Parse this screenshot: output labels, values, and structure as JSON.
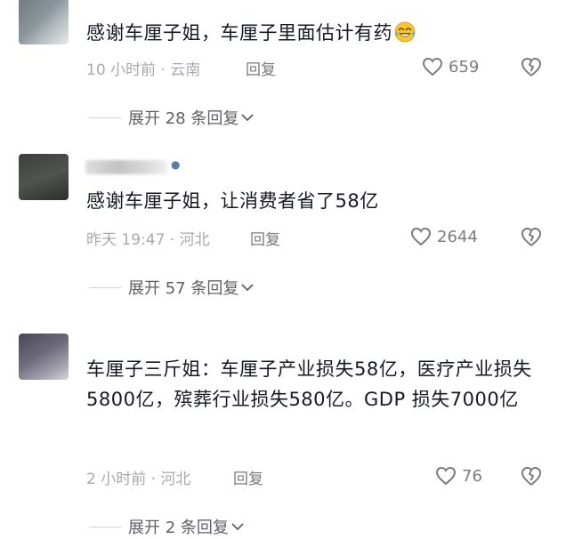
{
  "comments": [
    {
      "text": "感谢车厘子姐，车厘子里面估计有药",
      "emoji": "laughing-crying-emoji",
      "time_location": "10 小时前 · 云南",
      "reply_label": "回复",
      "likes": "659",
      "expand_label": "展开 28 条回复"
    },
    {
      "text": "感谢车厘子姐，让消费者省了58亿",
      "time_location": "昨天 19:47 · 河北",
      "reply_label": "回复",
      "likes": "2644",
      "expand_label": "展开 57 条回复"
    },
    {
      "text": "车厘子三斤姐：车厘子产业损失58亿，医疗产业损失5800亿，殡葬行业损失580亿。GDP 损失7000亿",
      "time_location": "2 小时前 · 河北",
      "reply_label": "回复",
      "likes": "76",
      "expand_label": "展开 2 条回复"
    }
  ],
  "colors": {
    "text": "#161823",
    "meta": "#a8a9ae",
    "icon": "#7a7b80"
  }
}
